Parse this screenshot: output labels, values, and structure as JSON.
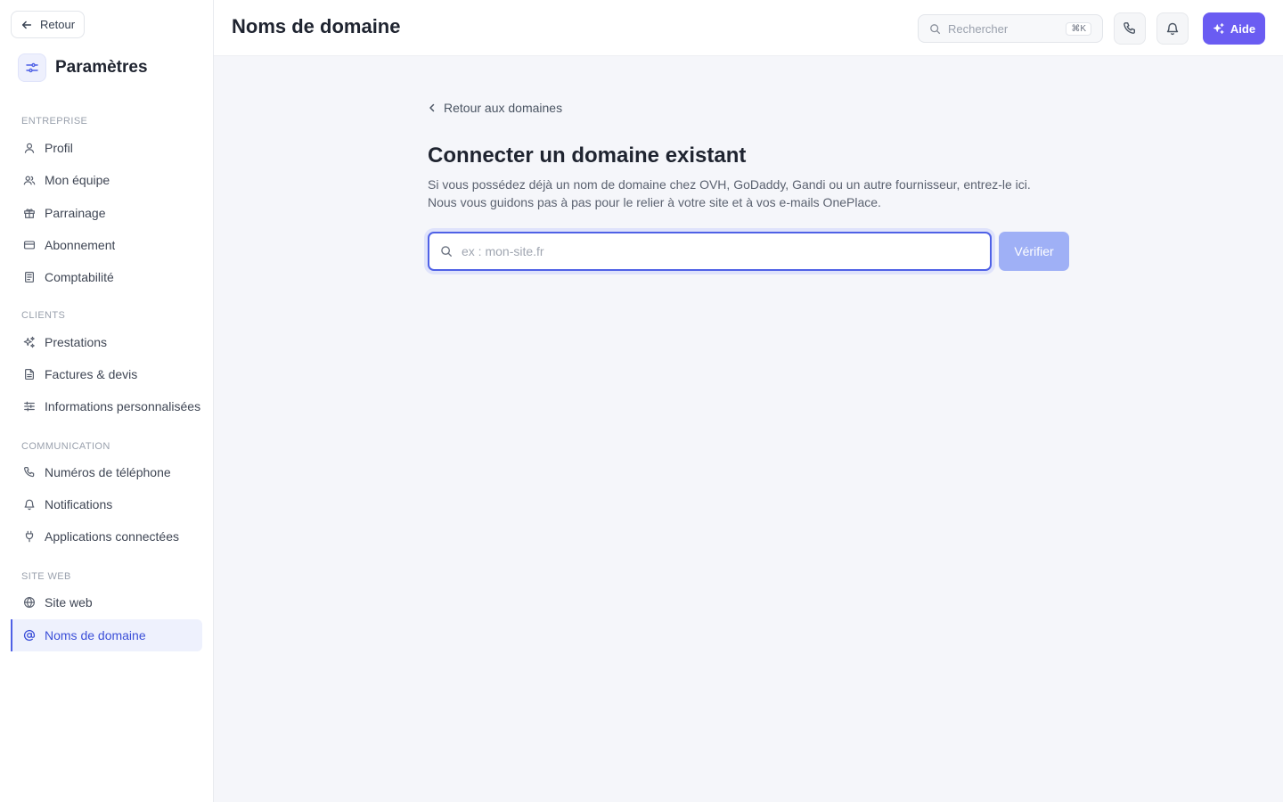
{
  "sidebar": {
    "back_label": "Retour",
    "title": "Paramètres",
    "sections": [
      {
        "label": "ENTREPRISE",
        "items": [
          {
            "label": "Profil",
            "icon": "user-icon"
          },
          {
            "label": "Mon équipe",
            "icon": "users-icon"
          },
          {
            "label": "Parrainage",
            "icon": "gift-icon"
          },
          {
            "label": "Abonnement",
            "icon": "credit-card-icon"
          },
          {
            "label": "Comptabilité",
            "icon": "ledger-icon"
          }
        ]
      },
      {
        "label": "CLIENTS",
        "items": [
          {
            "label": "Prestations",
            "icon": "sparkles-icon"
          },
          {
            "label": "Factures & devis",
            "icon": "file-text-icon"
          },
          {
            "label": "Informations personnalisées",
            "icon": "sliders-icon"
          }
        ]
      },
      {
        "label": "COMMUNICATION",
        "items": [
          {
            "label": "Numéros de téléphone",
            "icon": "phone-icon"
          },
          {
            "label": "Notifications",
            "icon": "bell-icon"
          },
          {
            "label": "Applications connectées",
            "icon": "plug-icon"
          }
        ]
      },
      {
        "label": "SITE WEB",
        "items": [
          {
            "label": "Site web",
            "icon": "globe-icon"
          },
          {
            "label": "Noms de domaine",
            "icon": "at-sign-icon",
            "active": true
          }
        ]
      }
    ]
  },
  "header": {
    "title": "Noms de domaine",
    "search_placeholder": "Rechercher",
    "search_shortcut": "⌘K",
    "help_label": "Aide"
  },
  "main": {
    "back_link": "Retour aux domaines",
    "heading": "Connecter un domaine existant",
    "description_line1": "Si vous possédez déjà un nom de domaine chez OVH, GoDaddy, Gandi ou un autre fournisseur, entrez-le ici.",
    "description_line2": "Nous vous guidons pas à pas pour le relier à votre site et à vos e-mails OnePlace.",
    "input_placeholder": "ex : mon-site.fr",
    "input_value": "",
    "verify_label": "Vérifier"
  },
  "colors": {
    "accent": "#4f61e6",
    "help_button": "#6a5cf2",
    "verify_button_disabled": "#9fb0f6",
    "active_nav_bg": "#eef1fd"
  }
}
